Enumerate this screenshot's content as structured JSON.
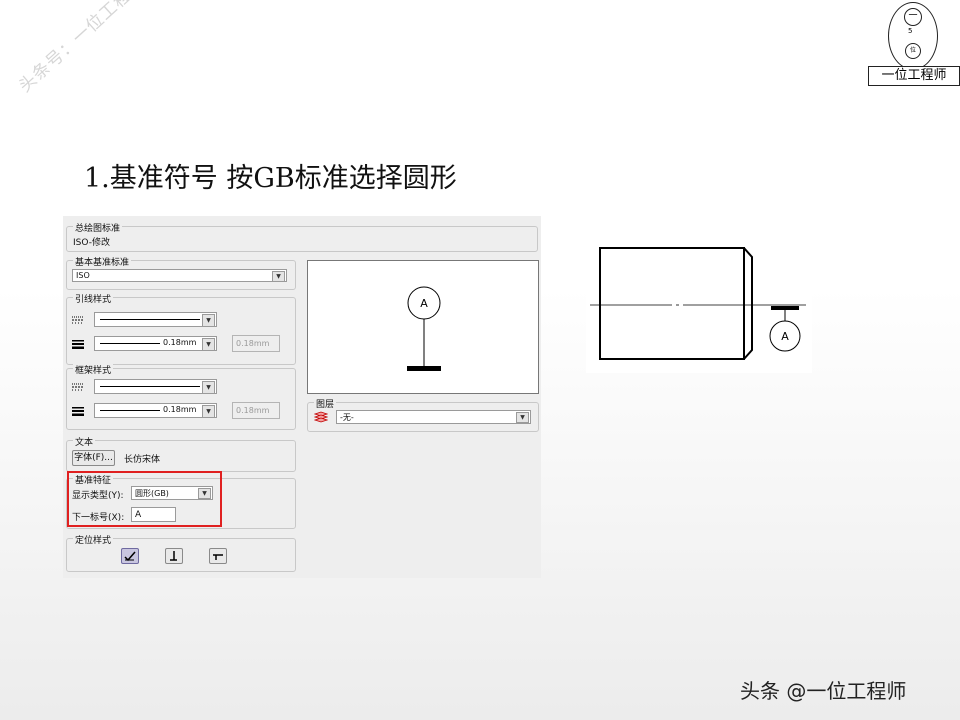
{
  "watermark": "头条号：一位工程师",
  "logo": {
    "text": "一位工程师",
    "top_glyph": "一",
    "mid_glyph": "5",
    "bottom_glyph": "位"
  },
  "slide_title": "1.基准符号 按GB标准选择圆形",
  "dialog": {
    "overall_standard": {
      "label": "总绘图标准",
      "value": "ISO-修改"
    },
    "basic_datum_standard": {
      "label": "基本基准标准",
      "value": "ISO"
    },
    "leader_style": {
      "label": "引线样式",
      "width_value": "0.18mm",
      "width_field": "0.18mm"
    },
    "frame_style": {
      "label": "框架样式",
      "width_value": "0.18mm",
      "width_field": "0.18mm"
    },
    "text": {
      "label": "文本",
      "font_button": "字体(F)...",
      "font_name": "长仿宋体"
    },
    "datum_feature": {
      "label": "基准特征",
      "display_type_label": "显示类型(Y):",
      "display_type_value": "圆形(GB)",
      "next_label_label": "下一标号(X):",
      "next_label_value": "A"
    },
    "position_style": {
      "label": "定位样式"
    },
    "layer": {
      "label": "图层",
      "value": "-无-"
    },
    "preview": {
      "datum_letter": "A"
    }
  },
  "drawing": {
    "datum_letter": "A"
  },
  "footer": "头条 @一位工程师"
}
